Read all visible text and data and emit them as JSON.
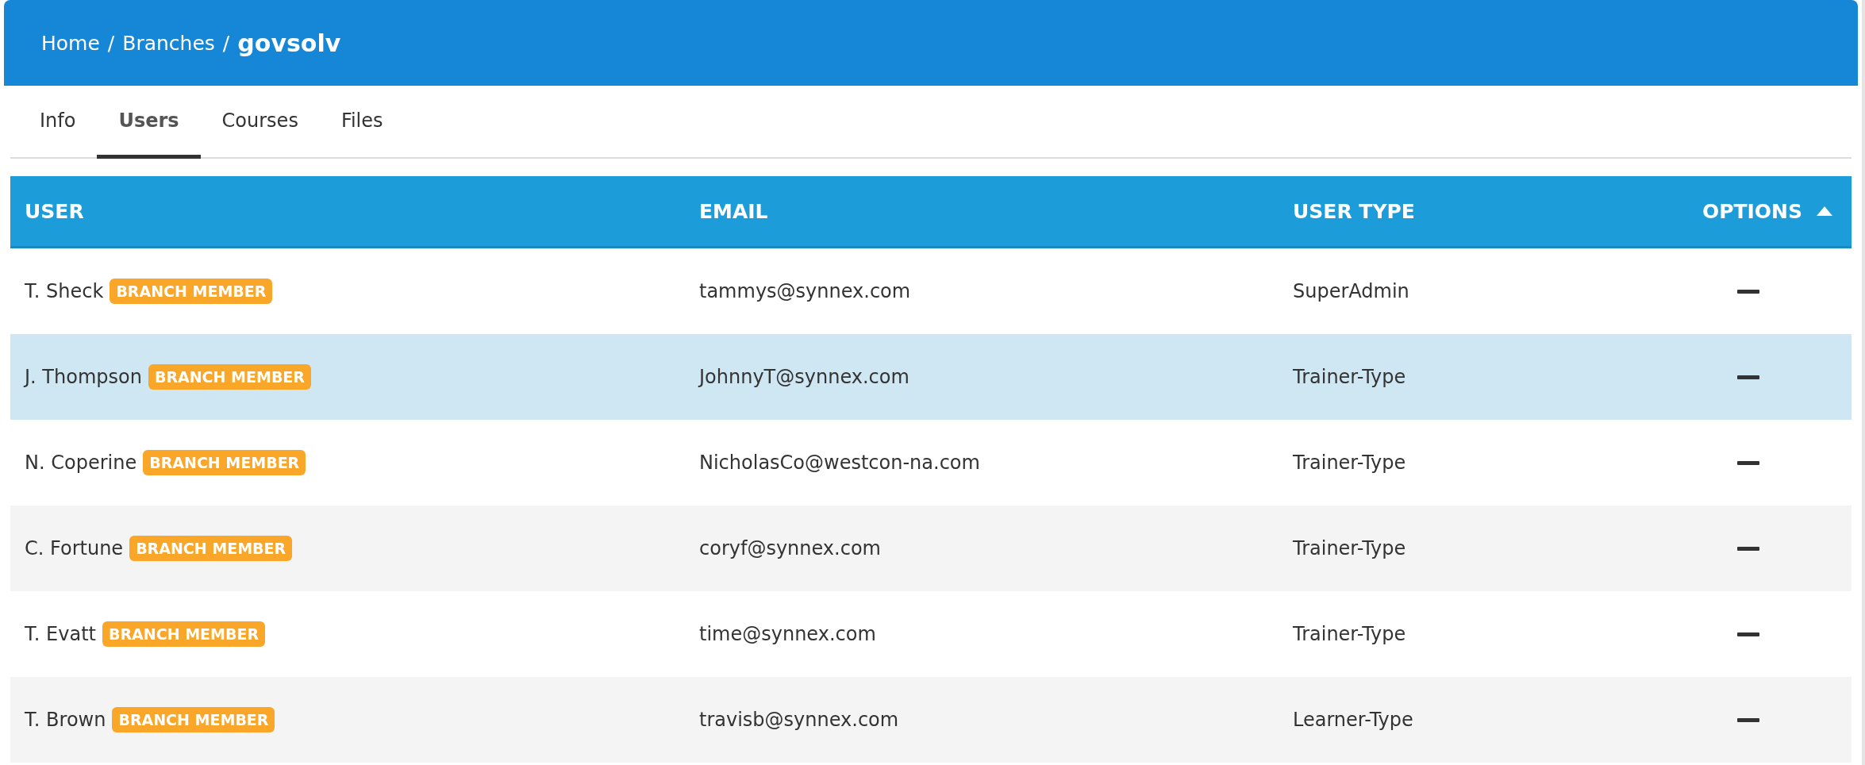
{
  "breadcrumb": {
    "items": [
      "Home",
      "Branches"
    ],
    "separator": "/",
    "current": "govsolv"
  },
  "tabs": [
    {
      "label": "Info",
      "selected": false
    },
    {
      "label": "Users",
      "selected": true
    },
    {
      "label": "Courses",
      "selected": false
    },
    {
      "label": "Files",
      "selected": false
    }
  ],
  "table": {
    "columns": [
      {
        "label": "USER",
        "sorted": false
      },
      {
        "label": "EMAIL",
        "sorted": false
      },
      {
        "label": "USER TYPE",
        "sorted": false
      },
      {
        "label": "OPTIONS",
        "sorted": true
      }
    ],
    "rows": [
      {
        "user": "T. Sheck",
        "badge": "BRANCH MEMBER",
        "email": "tammys@synnex.com",
        "user_type": "SuperAdmin",
        "selected": false
      },
      {
        "user": "J. Thompson",
        "badge": "BRANCH MEMBER",
        "email": "JohnnyT@synnex.com",
        "user_type": "Trainer-Type",
        "selected": true
      },
      {
        "user": "N. Coperine",
        "badge": "BRANCH MEMBER",
        "email": "NicholasCo@westcon-na.com",
        "user_type": "Trainer-Type",
        "selected": false
      },
      {
        "user": "C. Fortune",
        "badge": "BRANCH MEMBER",
        "email": "coryf@synnex.com",
        "user_type": "Trainer-Type",
        "selected": false
      },
      {
        "user": "T. Evatt",
        "badge": "BRANCH MEMBER",
        "email": "time@synnex.com",
        "user_type": "Trainer-Type",
        "selected": false
      },
      {
        "user": "T. Brown",
        "badge": "BRANCH MEMBER",
        "email": "travisb@synnex.com",
        "user_type": "Learner-Type",
        "selected": false
      }
    ]
  }
}
